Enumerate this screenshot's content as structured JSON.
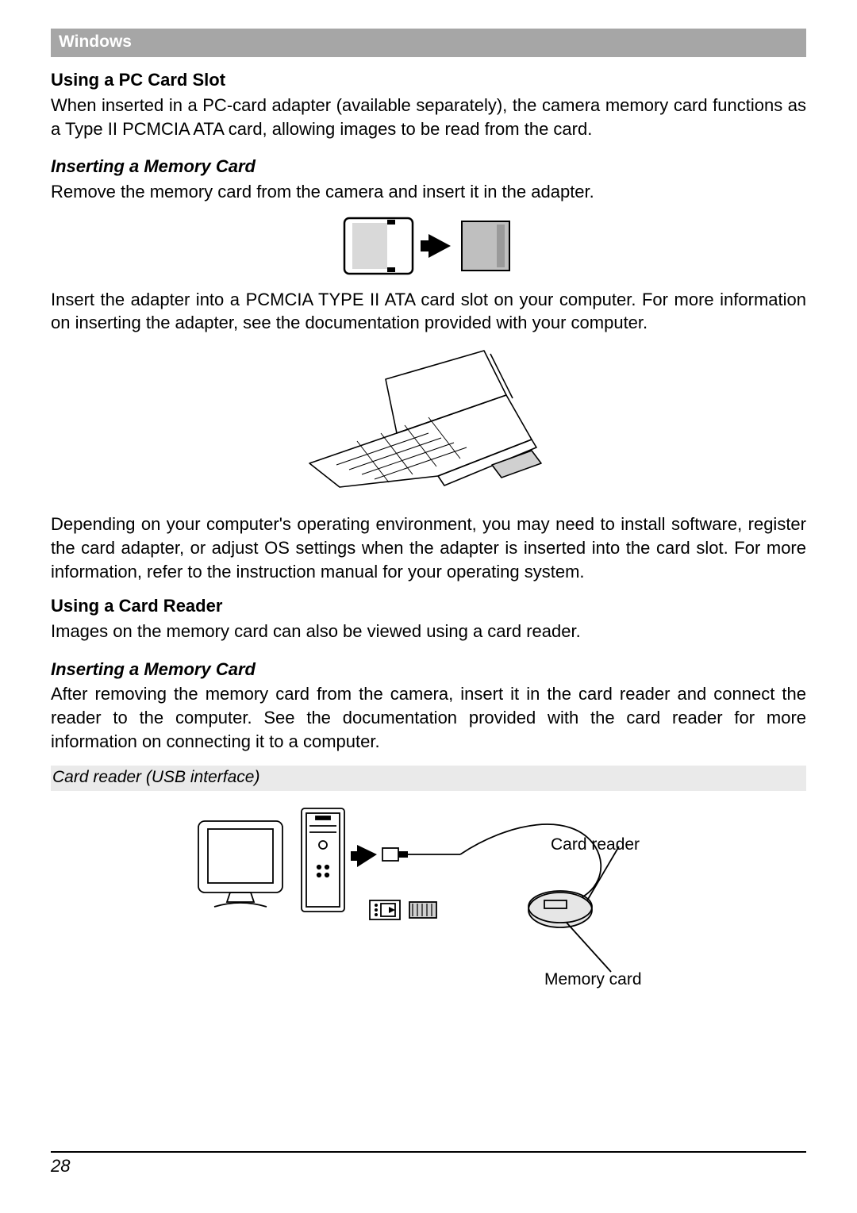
{
  "header": "Windows",
  "pc_card": {
    "title": "Using a PC Card Slot",
    "p1": "When inserted in a PC-card adapter (available separately), the camera memory card functions as a Type II PCMCIA ATA card, allowing images to be read from the card."
  },
  "insert1": {
    "title": "Inserting a Memory Card",
    "p1": "Remove the memory card from the camera and insert it in the adapter.",
    "p2": "Insert the adapter into a PCMCIA TYPE II ATA card slot on your computer. For more information on inserting the adapter, see the documentation provided with your computer.",
    "p3": "Depending on your computer's operating environment, you may need to install software, register the card adapter, or adjust OS settings when the adapter is inserted into the card slot. For more information, refer to the instruction manual for your operating system."
  },
  "card_reader": {
    "title": "Using a Card Reader",
    "p1": "Images on the memory card can also be viewed using a card reader."
  },
  "insert2": {
    "title": "Inserting a Memory Card",
    "p1": "After removing the memory card from the camera, insert it in the card reader and connect the reader to the computer. See the documentation provided with the card reader for more information on connecting it to a computer."
  },
  "usb_caption": "Card reader (USB interface)",
  "labels": {
    "card_reader": "Card reader",
    "memory_card": "Memory card"
  },
  "page_number": "28"
}
